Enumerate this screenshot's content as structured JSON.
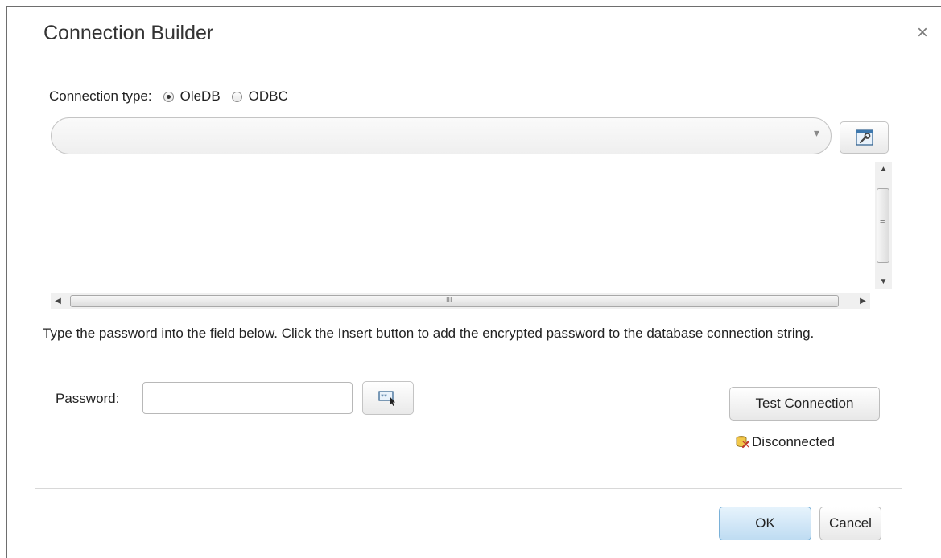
{
  "dialog": {
    "title": "Connection Builder",
    "close_glyph": "×"
  },
  "connection_type": {
    "label": "Connection type:",
    "options": [
      {
        "label": "OleDB",
        "selected": true
      },
      {
        "label": "ODBC",
        "selected": false
      }
    ]
  },
  "provider_select": {
    "value": "",
    "arrow_glyph": "▾"
  },
  "connection_string": {
    "value": ""
  },
  "scrollbars": {
    "up": "▲",
    "down": "▼",
    "left": "◀",
    "right": "▶"
  },
  "instructions": "Type the password into the field below. Click the Insert button to add the encrypted password to the database connection string.",
  "password": {
    "label": "Password:",
    "value": ""
  },
  "buttons": {
    "test_connection": "Test Connection",
    "ok": "OK",
    "cancel": "Cancel"
  },
  "status": {
    "text": "Disconnected",
    "icon": "database-disconnected-icon"
  },
  "colors": {
    "ok_accent": "#bfdcf2",
    "ok_border": "#7ab1d8"
  },
  "icons": {
    "wrench": "wrench-icon",
    "insert": "insert-password-icon",
    "close": "close-icon"
  }
}
